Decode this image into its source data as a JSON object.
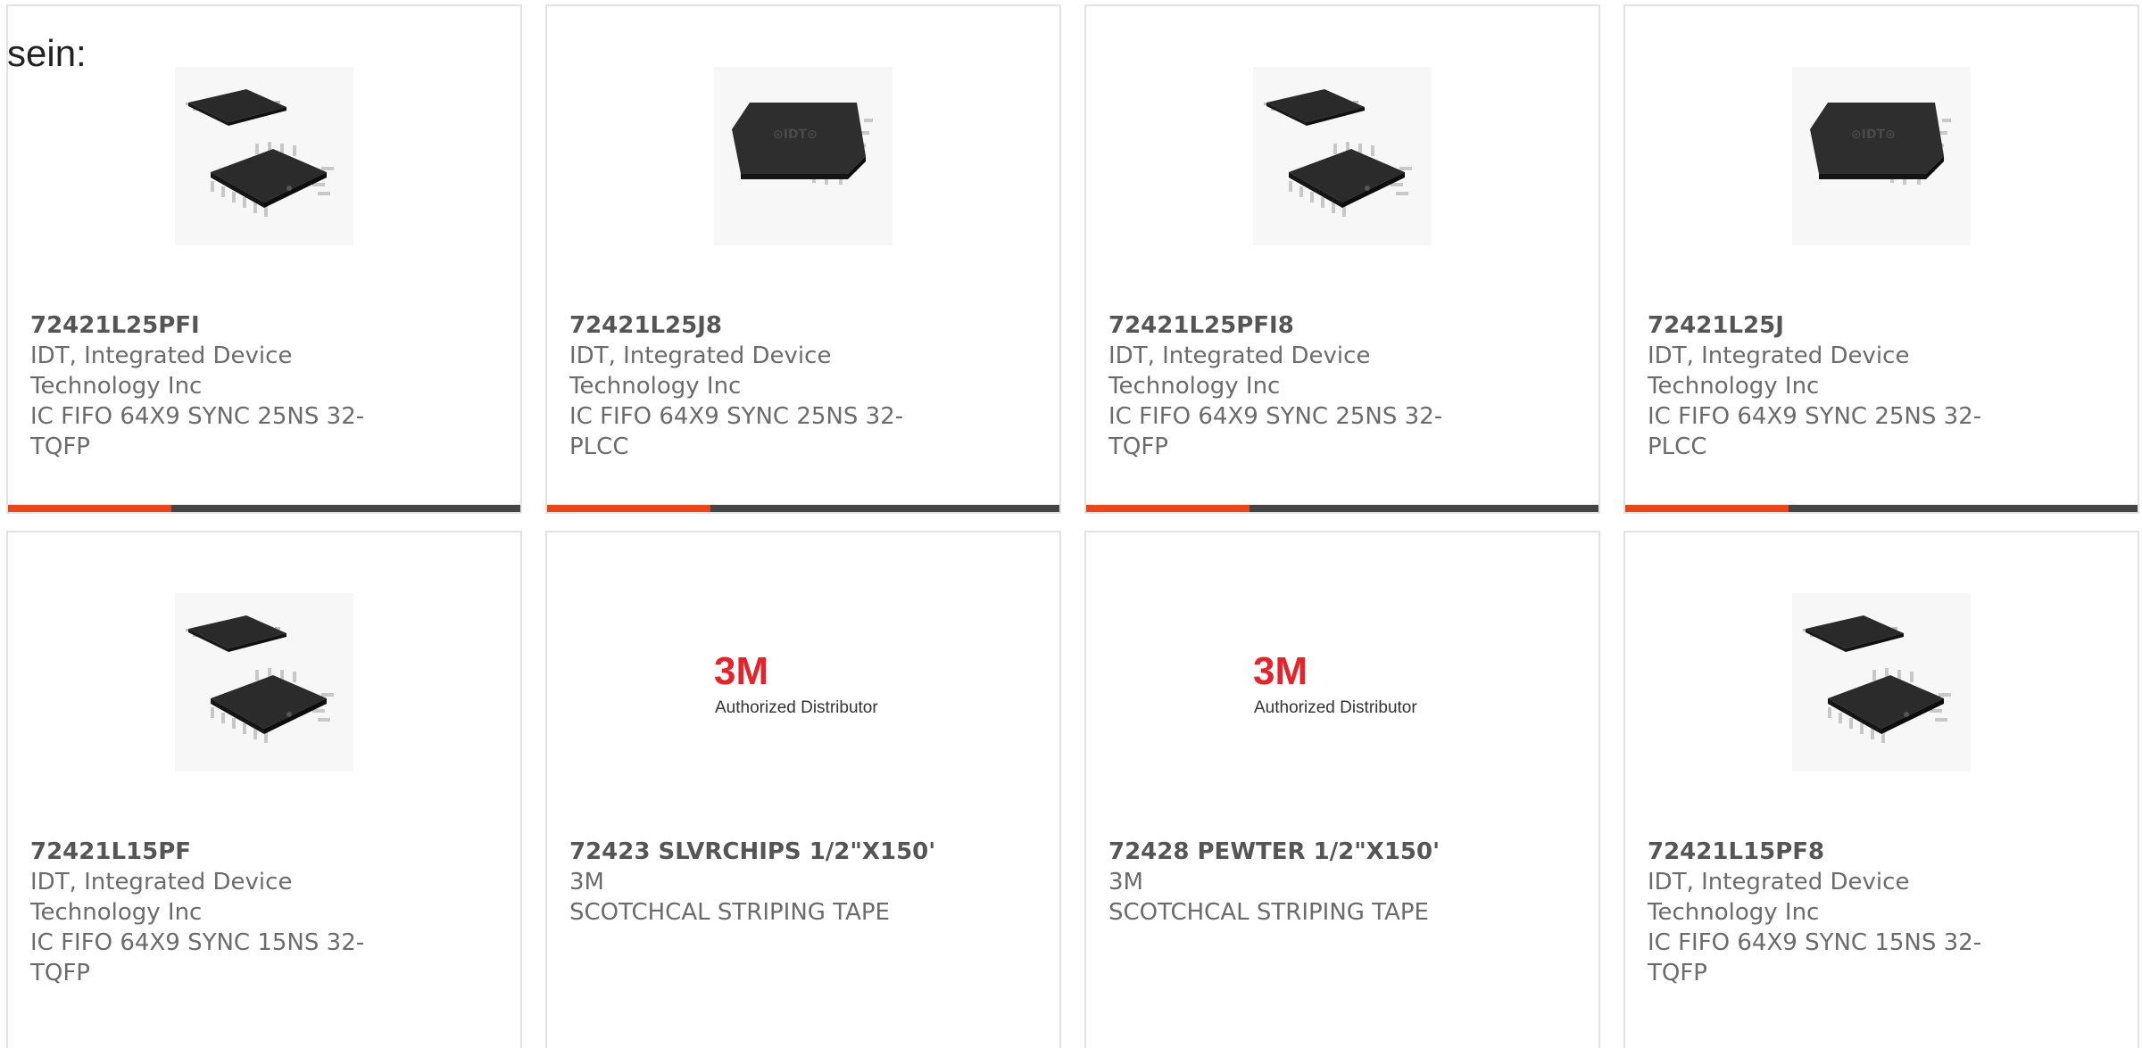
{
  "lead_text": "sein:",
  "products": [
    {
      "part": "72421L25PFI",
      "manufacturer": "IDT, Integrated Device Technology Inc",
      "description": "IC FIFO 64X9 SYNC 25NS 32-TQFP",
      "image": "tqfp-chip-image"
    },
    {
      "part": "72421L25J8",
      "manufacturer": "IDT, Integrated Device Technology Inc",
      "description": "IC FIFO 64X9 SYNC 25NS 32-PLCC",
      "image": "plcc-chip-image"
    },
    {
      "part": "72421L25PFI8",
      "manufacturer": "IDT, Integrated Device Technology Inc",
      "description": "IC FIFO 64X9 SYNC 25NS 32-TQFP",
      "image": "tqfp-chip-image"
    },
    {
      "part": "72421L25J",
      "manufacturer": "IDT, Integrated Device Technology Inc",
      "description": "IC FIFO 64X9 SYNC 25NS 32-PLCC",
      "image": "plcc-chip-image"
    },
    {
      "part": "72421L15PF",
      "manufacturer": "IDT, Integrated Device Technology Inc",
      "description": "IC FIFO 64X9 SYNC 15NS 32-TQFP",
      "image": "tqfp-chip-image"
    },
    {
      "part": "72423 SLVRCHIPS 1/2\"X150'",
      "manufacturer": "3M",
      "description": "SCOTCHCAL STRIPING TAPE",
      "image": "3m-logo",
      "logo_text": "3M",
      "logo_caption": "Authorized Distributor"
    },
    {
      "part": "72428 PEWTER 1/2\"X150'",
      "manufacturer": "3M",
      "description": "SCOTCHCAL STRIPING TAPE",
      "image": "3m-logo",
      "logo_text": "3M",
      "logo_caption": "Authorized Distributor"
    },
    {
      "part": "72421L15PF8",
      "manufacturer": "IDT, Integrated Device Technology Inc",
      "description": "IC FIFO 64X9 SYNC 15NS 32-TQFP",
      "image": "tqfp-chip-image"
    }
  ],
  "colors": {
    "accent": "#e8461b",
    "bar": "#444444",
    "logo_red": "#e3242b"
  }
}
